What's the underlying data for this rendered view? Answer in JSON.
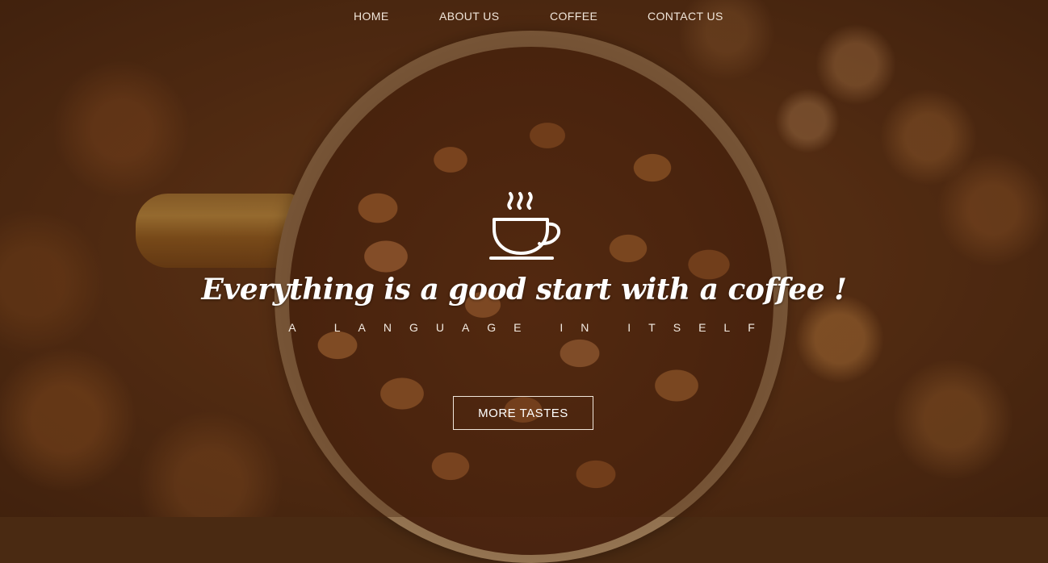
{
  "nav": {
    "items": [
      {
        "label": "HOME"
      },
      {
        "label": "ABOUT US"
      },
      {
        "label": "COFFEE"
      },
      {
        "label": "CONTACT US"
      }
    ]
  },
  "hero": {
    "icon": "coffee-cup-icon",
    "headline": "Everything is a good start with a coffee !",
    "tagline": "A LANGUAGE IN ITSELF",
    "cta_label": "MORE TASTES"
  },
  "colors": {
    "text": "#ffffff",
    "overlay": "#4a2a12",
    "accent": "#f0e6da"
  }
}
